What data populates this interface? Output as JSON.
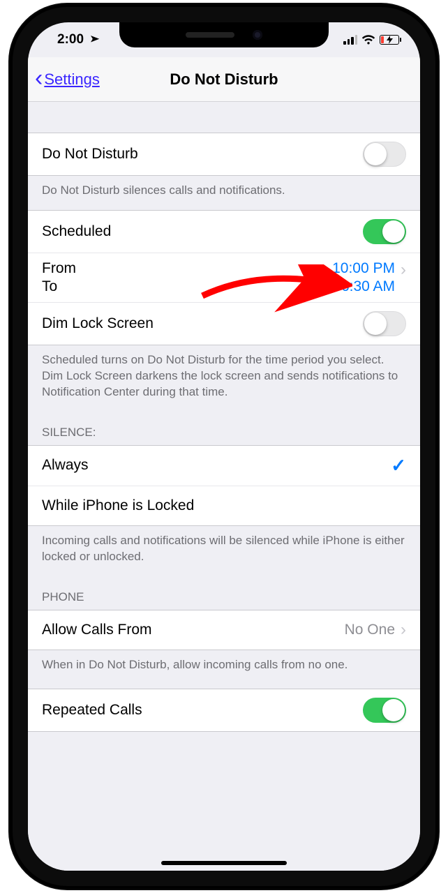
{
  "status": {
    "time": "2:00",
    "location_active": true
  },
  "nav": {
    "back_label": "Settings",
    "title": "Do Not Disturb"
  },
  "dnd": {
    "main_label": "Do Not Disturb",
    "main_on": false,
    "main_footer": "Do Not Disturb silences calls and notifications."
  },
  "scheduled": {
    "label": "Scheduled",
    "on": true,
    "from_label": "From",
    "to_label": "To",
    "from_value": "10:00 PM",
    "to_value": "6:30 AM",
    "dim_label": "Dim Lock Screen",
    "dim_on": false,
    "footer": "Scheduled turns on Do Not Disturb for the time period you select. Dim Lock Screen darkens the lock screen and sends notifications to Notification Center during that time."
  },
  "silence": {
    "header": "SILENCE:",
    "options": {
      "always": "Always",
      "locked": "While iPhone is Locked"
    },
    "selected": "always",
    "footer": "Incoming calls and notifications will be silenced while iPhone is either locked or unlocked."
  },
  "phone": {
    "header": "PHONE",
    "allow_label": "Allow Calls From",
    "allow_value": "No One",
    "allow_footer": "When in Do Not Disturb, allow incoming calls from no one.",
    "repeated_label": "Repeated Calls",
    "repeated_on": true
  }
}
